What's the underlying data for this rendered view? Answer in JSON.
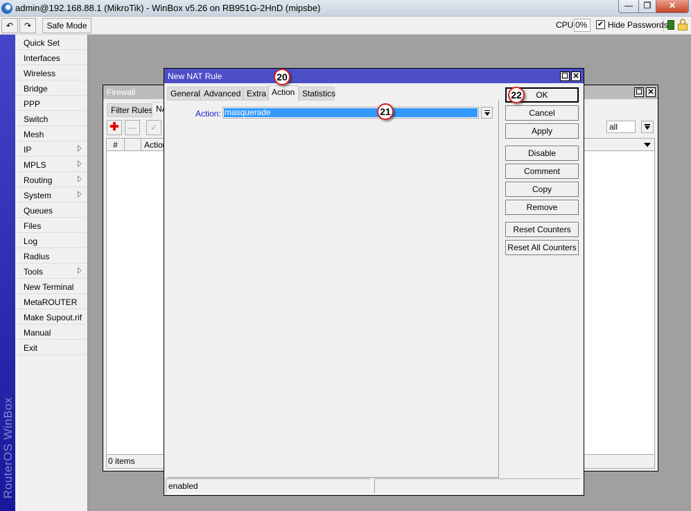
{
  "window": {
    "title": "admin@192.168.88.1 (MikroTik) - WinBox v5.26 on RB951G-2HnD (mipsbe)",
    "min_glyph": "—",
    "max_glyph": "❐",
    "close_glyph": "✕"
  },
  "toolbar": {
    "undo_glyph": "↶",
    "redo_glyph": "↷",
    "safe_mode_label": "Safe Mode",
    "cpu_label": "CPU:",
    "cpu_value": "0%",
    "hide_passwords_checked": true,
    "hide_passwords_check_glyph": "✔",
    "hide_passwords_label": "Hide Passwords"
  },
  "brand": {
    "text": "RouterOS WinBox"
  },
  "menu": {
    "items": [
      {
        "label": "Quick Set",
        "submenu": false
      },
      {
        "label": "Interfaces",
        "submenu": false
      },
      {
        "label": "Wireless",
        "submenu": false
      },
      {
        "label": "Bridge",
        "submenu": false
      },
      {
        "label": "PPP",
        "submenu": false
      },
      {
        "label": "Switch",
        "submenu": false
      },
      {
        "label": "Mesh",
        "submenu": false
      },
      {
        "label": "IP",
        "submenu": true
      },
      {
        "label": "MPLS",
        "submenu": true
      },
      {
        "label": "Routing",
        "submenu": true
      },
      {
        "label": "System",
        "submenu": true
      },
      {
        "label": "Queues",
        "submenu": false
      },
      {
        "label": "Files",
        "submenu": false
      },
      {
        "label": "Log",
        "submenu": false
      },
      {
        "label": "Radius",
        "submenu": false
      },
      {
        "label": "Tools",
        "submenu": true
      },
      {
        "label": "New Terminal",
        "submenu": false
      },
      {
        "label": "MetaROUTER",
        "submenu": false
      },
      {
        "label": "Make Supout.rif",
        "submenu": false
      },
      {
        "label": "Manual",
        "submenu": false
      },
      {
        "label": "Exit",
        "submenu": false
      }
    ]
  },
  "firewall": {
    "title": "Firewall",
    "tabs": [
      "Filter Rules",
      "NAT"
    ],
    "add_glyph": "✚",
    "remove_glyph": "—",
    "enable_glyph": "✓",
    "columns": [
      "#",
      "",
      "Action"
    ],
    "filter_value": "all",
    "status": "0 items",
    "max_glyph": "☐",
    "close_glyph": "✕"
  },
  "dialog": {
    "title": "New NAT Rule",
    "tabs": [
      "General",
      "Advanced",
      "Extra",
      "Action",
      "Statistics"
    ],
    "active_tab": "Action",
    "action_label": "Action:",
    "action_value": "masquerade",
    "buttons": {
      "ok": "OK",
      "cancel": "Cancel",
      "apply": "Apply",
      "disable": "Disable",
      "comment": "Comment",
      "copy": "Copy",
      "remove": "Remove",
      "reset_counters": "Reset Counters",
      "reset_all_counters": "Reset All Counters"
    },
    "status": "enabled",
    "max_glyph": "☐",
    "close_glyph": "✕"
  },
  "annotations": [
    "20",
    "21",
    "22"
  ],
  "colors": {
    "dialog_title_bar": "#4d4fc8",
    "selection": "#3399ff",
    "brand_bar": "#3334b8",
    "add_icon": "#e00000",
    "annotation_ring": "#d62020"
  }
}
